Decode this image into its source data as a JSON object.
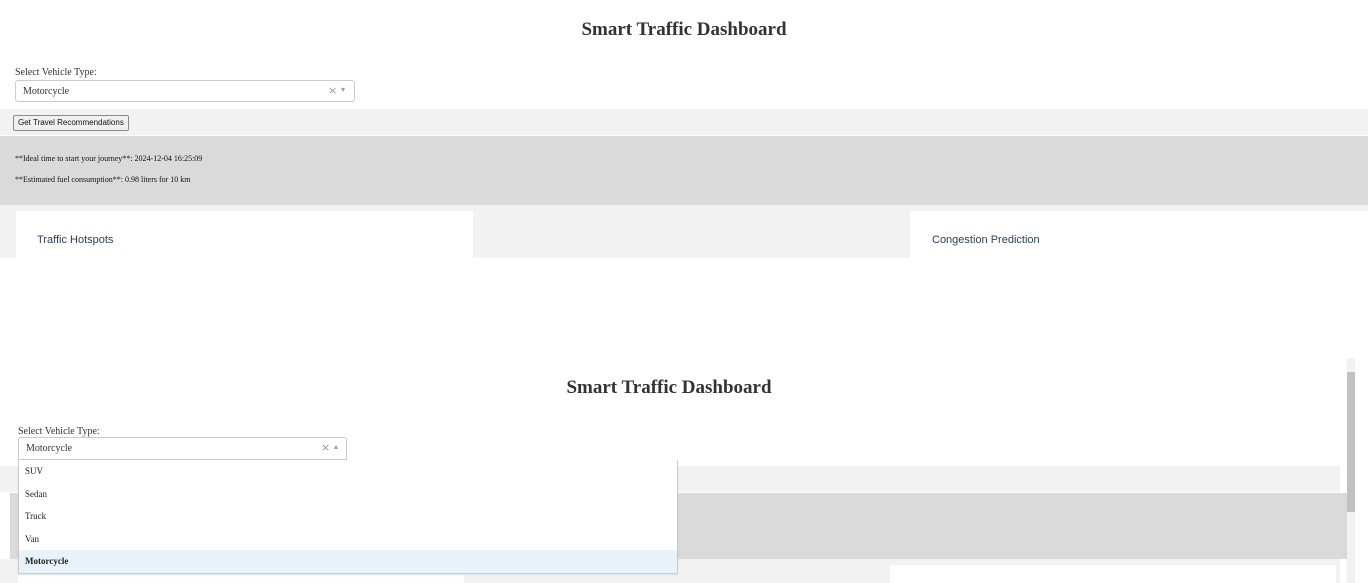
{
  "panel1": {
    "title": "Smart Traffic Dashboard",
    "vehicle_label": "Select Vehicle Type:",
    "vehicle_value": "Motorcycle",
    "clear_glyph": "×",
    "arrow_glyph": "▾",
    "button_label": "Get Travel Recommendations",
    "rec_time": "**Ideal time to start your journey**: 2024-12-04 16:25:09",
    "rec_fuel": "**Estimated fuel consumption**: 0.98 liters for 10 km",
    "hotspots_title": "Traffic Hotspots",
    "congestion_title": "Congestion Prediction"
  },
  "panel2": {
    "title": "Smart Traffic Dashboard",
    "vehicle_label": "Select Vehicle Type:",
    "vehicle_value": "Motorcycle",
    "clear_glyph": "×",
    "arrow_glyph": "▴",
    "options": [
      "SUV",
      "Sedan",
      "Truck",
      "Van",
      "Motorcycle"
    ],
    "selected_option": "Motorcycle"
  }
}
